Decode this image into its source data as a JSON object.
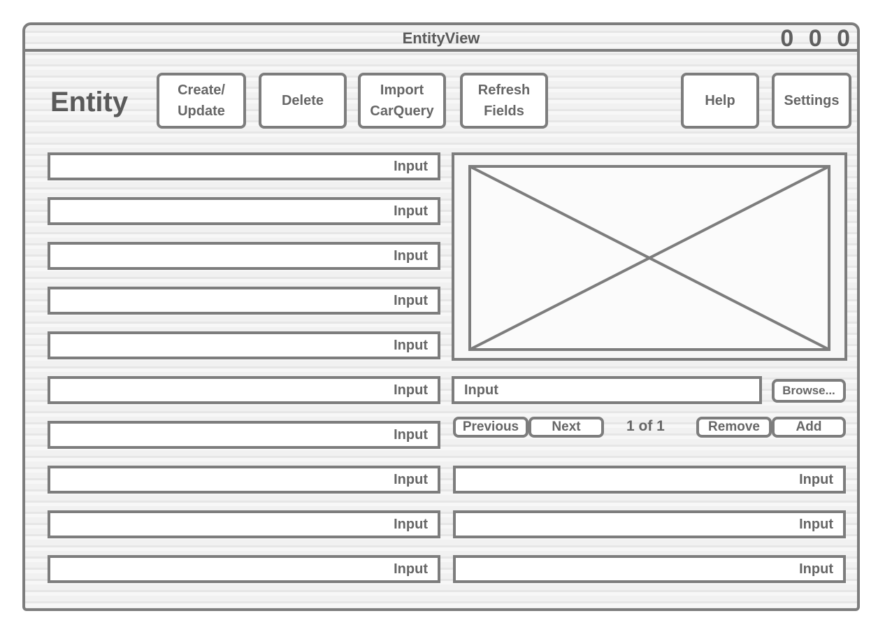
{
  "window": {
    "title": "EntityView",
    "controls": "0 0 0"
  },
  "page": {
    "heading": "Entity"
  },
  "toolbar": {
    "create_update": "Create/\nUpdate",
    "delete": "Delete",
    "import_carquery": "Import\nCarQuery",
    "refresh_fields": "Refresh\nFields",
    "help": "Help",
    "settings": "Settings"
  },
  "left_fields": [
    "Input",
    "Input",
    "Input",
    "Input",
    "Input",
    "Input",
    "Input",
    "Input",
    "Input",
    "Input"
  ],
  "image_section": {
    "path_input": "Input",
    "browse": "Browse...",
    "previous": "Previous",
    "next": "Next",
    "page_indicator": "1 of 1",
    "remove": "Remove",
    "add": "Add"
  },
  "right_fields": [
    "Input",
    "Input",
    "Input"
  ]
}
